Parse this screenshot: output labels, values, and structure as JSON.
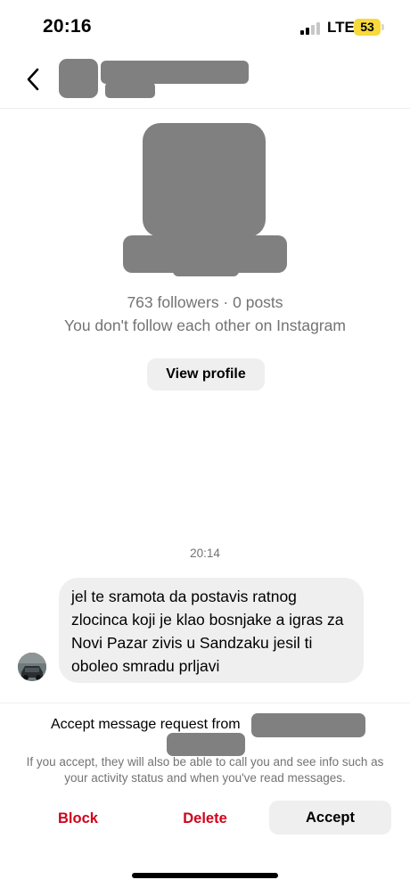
{
  "status_bar": {
    "time": "20:16",
    "network": "LTE",
    "battery": "53",
    "battery_color": "#f7d93c"
  },
  "header": {
    "back_icon": "chevron-left-icon"
  },
  "profile": {
    "followers_line": "763 followers · 0 posts",
    "follow_status": "You don't follow each other on Instagram",
    "view_profile_label": "View profile"
  },
  "conversation": {
    "timestamp": "20:14",
    "message": "jel te sramota da postavis ratnog zlocinca koji je klao bosnjake a igras za Novi Pazar zivis u Sandzaku jesil ti oboleo smradu prljavi"
  },
  "request": {
    "prompt": "Accept message request from",
    "info": "If you accept, they will also be able to call you and see info such as your activity status and when you've read messages.",
    "block_label": "Block",
    "delete_label": "Delete",
    "accept_label": "Accept",
    "danger_color": "#d0021b"
  }
}
